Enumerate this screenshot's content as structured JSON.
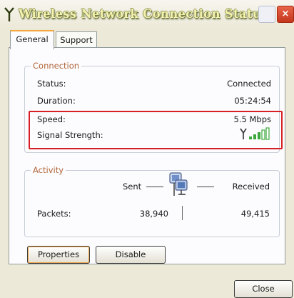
{
  "window": {
    "title": "Wireless Network Connection Status",
    "close_glyph": "×"
  },
  "tabs": [
    {
      "label": "General",
      "selected": true
    },
    {
      "label": "Support",
      "selected": false
    }
  ],
  "connection": {
    "group_label": "Connection",
    "status_label": "Status:",
    "status_value": "Connected",
    "duration_label": "Duration:",
    "duration_value": "05:24:54",
    "speed_label": "Speed:",
    "speed_value": "5.5 Mbps",
    "signal_label": "Signal Strength:",
    "signal_icon": "signal-strength-icon"
  },
  "activity": {
    "group_label": "Activity",
    "sent_label": "Sent",
    "received_label": "Received",
    "packets_label": "Packets:",
    "packets_sent": "38,940",
    "packets_received": "49,415",
    "icon": "network-computers-icon"
  },
  "buttons": {
    "properties": "Properties",
    "disable": "Disable",
    "close": "Close"
  },
  "colors": {
    "highlight_box": "#d62025",
    "group_title": "#b06438",
    "window_bg": "#ece9d8",
    "signal_bars": "#3aa83a"
  }
}
